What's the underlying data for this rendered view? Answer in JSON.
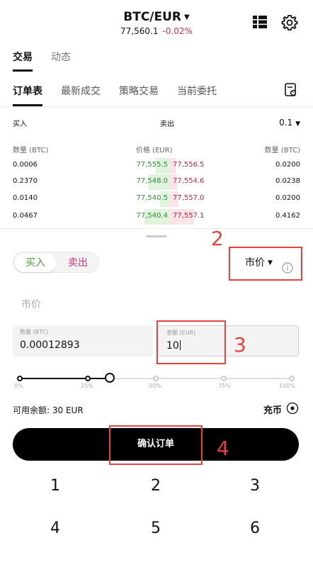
{
  "header": {
    "pair": "BTC/EUR",
    "price": "77,560.1",
    "change": "-0.02%"
  },
  "colors": {
    "up": "#2e8b3d",
    "down": "#b0283f",
    "buy": "#43a23a",
    "sell": "#c8327a",
    "annotation": "#e8423a"
  },
  "top_tabs": [
    {
      "label": "交易"
    },
    {
      "label": "动态"
    }
  ],
  "sub_tabs": [
    {
      "label": "订单表"
    },
    {
      "label": "最新成交"
    },
    {
      "label": "策略交易"
    },
    {
      "label": "当前委托"
    }
  ],
  "orderbook": {
    "buy_label": "买入",
    "sell_label": "卖出",
    "step": "0.1",
    "col_qty": "数量 (BTC)",
    "col_price": "价格 (EUR)",
    "col_qty_sell": "数量 (BTC)",
    "rows": [
      {
        "qty": "0.0006",
        "bid": "77,555.5",
        "ask": "77,556.5",
        "sell_qty": "0.0200"
      },
      {
        "qty": "0.2370",
        "bid": "77,548.0",
        "ask": "77,554.6",
        "sell_qty": "0.0238"
      },
      {
        "qty": "0.0140",
        "bid": "77,540.5",
        "ask": "77,557.0",
        "sell_qty": "0.0200"
      },
      {
        "qty": "0.0467",
        "bid": "77,540.4",
        "ask": "77,557.1",
        "sell_qty": "0.4162"
      }
    ]
  },
  "order_form": {
    "buy": "买入",
    "sell": "卖出",
    "order_type": "市价",
    "price_placeholder": "市价",
    "qty_label": "数量 (BTC)",
    "qty_value": "0.00012893",
    "amount_label": "金额 (EUR)",
    "amount_value": "10",
    "slider_value": 0.33,
    "slider_ticks": [
      "0%",
      "25%",
      "50%",
      "75%",
      "100%"
    ],
    "available_label": "可用余额:",
    "available_value": "30 EUR",
    "deposit": "充币",
    "confirm": "确认订单"
  },
  "keypad": [
    "1",
    "2",
    "3",
    "4",
    "5",
    "6"
  ],
  "annotations": [
    "2",
    "3",
    "4"
  ]
}
